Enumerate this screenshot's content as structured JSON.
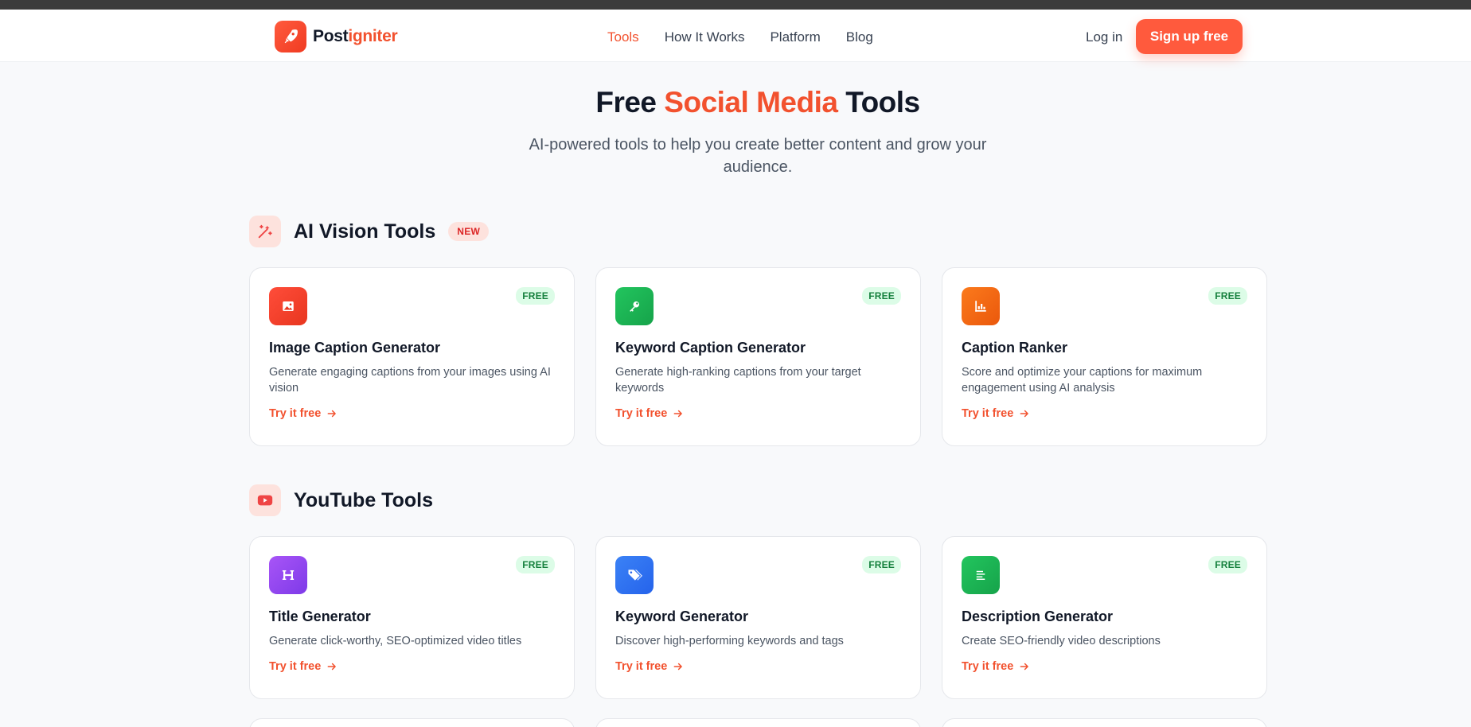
{
  "brand": {
    "name_part1": "Post",
    "name_part2": "igniter"
  },
  "nav": {
    "links": [
      {
        "label": "Tools",
        "active": true
      },
      {
        "label": "How It Works",
        "active": false
      },
      {
        "label": "Platform",
        "active": false
      },
      {
        "label": "Blog",
        "active": false
      }
    ],
    "login_label": "Log in",
    "signup_label": "Sign up free"
  },
  "hero": {
    "title_part1": "Free",
    "title_highlight": "Social Media",
    "title_part2": "Tools",
    "subtitle": "AI-powered tools to help you create better content and grow your audience."
  },
  "sections": [
    {
      "title": "AI Vision Tools",
      "badge": "NEW",
      "icon": "magic-wand-icon",
      "tools": [
        {
          "title": "Image Caption Generator",
          "description": "Generate engaging captions from your images using AI vision",
          "badge": "FREE",
          "cta": "Try it free",
          "icon": "image-icon",
          "color_start": "#ff4d3a",
          "color_end": "#e8361f"
        },
        {
          "title": "Keyword Caption Generator",
          "description": "Generate high-ranking captions from your target keywords",
          "badge": "FREE",
          "cta": "Try it free",
          "icon": "key-icon",
          "color_start": "#22c55e",
          "color_end": "#16a34a"
        },
        {
          "title": "Caption Ranker",
          "description": "Score and optimize your captions for maximum engagement using AI analysis",
          "badge": "FREE",
          "cta": "Try it free",
          "icon": "bar-chart-icon",
          "color_start": "#fb7a1c",
          "color_end": "#ea580c"
        }
      ]
    },
    {
      "title": "YouTube Tools",
      "icon": "youtube-icon",
      "tools": [
        {
          "title": "Title Generator",
          "description": "Generate click-worthy, SEO-optimized video titles",
          "badge": "FREE",
          "cta": "Try it free",
          "icon": "heading-icon",
          "color_start": "#a855f7",
          "color_end": "#7e3ae8"
        },
        {
          "title": "Keyword Generator",
          "description": "Discover high-performing keywords and tags",
          "badge": "FREE",
          "cta": "Try it free",
          "icon": "tags-icon",
          "color_start": "#3b82f6",
          "color_end": "#2563eb"
        },
        {
          "title": "Description Generator",
          "description": "Create SEO-friendly video descriptions",
          "badge": "FREE",
          "cta": "Try it free",
          "icon": "align-left-icon",
          "color_start": "#22c55e",
          "color_end": "#16a34a"
        }
      ]
    }
  ],
  "colors": {
    "accent": "#f2512e",
    "free_badge_bg": "#dcfce7",
    "free_badge_text": "#15803d"
  }
}
